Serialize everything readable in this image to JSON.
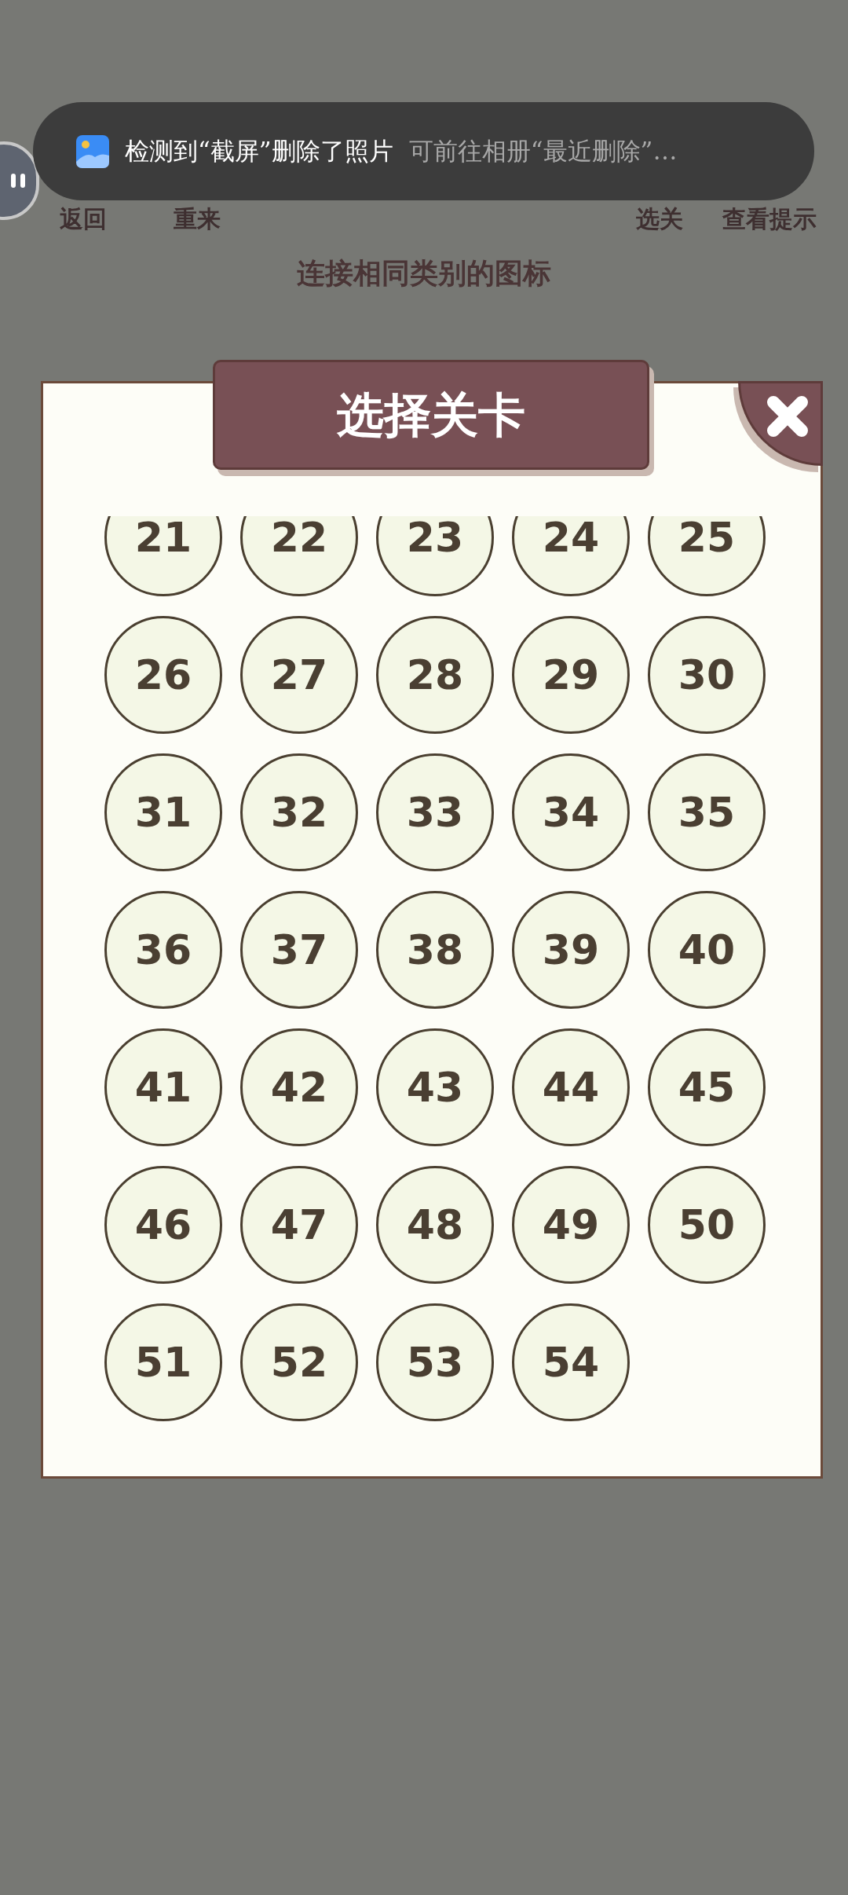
{
  "notification": {
    "text": "检测到“截屏”删除了照片",
    "hint": "可前往相册“最近删除”…"
  },
  "toolbar": {
    "left": [
      "返回",
      "重来"
    ],
    "right": [
      "选关",
      "查看提示"
    ]
  },
  "instruction": "连接相同类别的图标",
  "dialog": {
    "title": "选择关卡",
    "levels": [
      "21",
      "22",
      "23",
      "24",
      "25",
      "26",
      "27",
      "28",
      "29",
      "30",
      "31",
      "32",
      "33",
      "34",
      "35",
      "36",
      "37",
      "38",
      "39",
      "40",
      "41",
      "42",
      "43",
      "44",
      "45",
      "46",
      "47",
      "48",
      "49",
      "50",
      "51",
      "52",
      "53",
      "54"
    ]
  }
}
